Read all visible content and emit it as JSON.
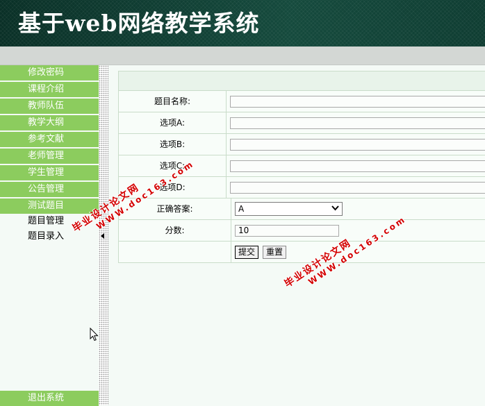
{
  "header": {
    "title": "基于web网络教学系统"
  },
  "sidebar": {
    "items": [
      {
        "label": "修改密码"
      },
      {
        "label": "课程介绍"
      },
      {
        "label": "教师队伍"
      },
      {
        "label": "教学大纲"
      },
      {
        "label": "参考文献"
      },
      {
        "label": "老师管理"
      },
      {
        "label": "学生管理"
      },
      {
        "label": "公告管理"
      },
      {
        "label": "测试题目"
      }
    ],
    "subitems": [
      {
        "label": "题目管理"
      },
      {
        "label": "题目录入"
      }
    ],
    "logout_label": "退出系统"
  },
  "form": {
    "title_label": "题目名称:",
    "option_a_label": "选项A:",
    "option_b_label": "选项B:",
    "option_c_label": "选项C:",
    "option_d_label": "选项D:",
    "answer_label": "正确答案:",
    "answer_value": "A",
    "score_label": "分数:",
    "score_value": "10",
    "submit_label": "提交",
    "reset_label": "重置"
  },
  "watermark": {
    "line1": "毕业设计论文网",
    "line2": "WWW.doc163.com"
  },
  "colors": {
    "header_bg": "#0f3d32",
    "menu_green": "#8ccc5e",
    "watermark_red": "#d30000"
  }
}
